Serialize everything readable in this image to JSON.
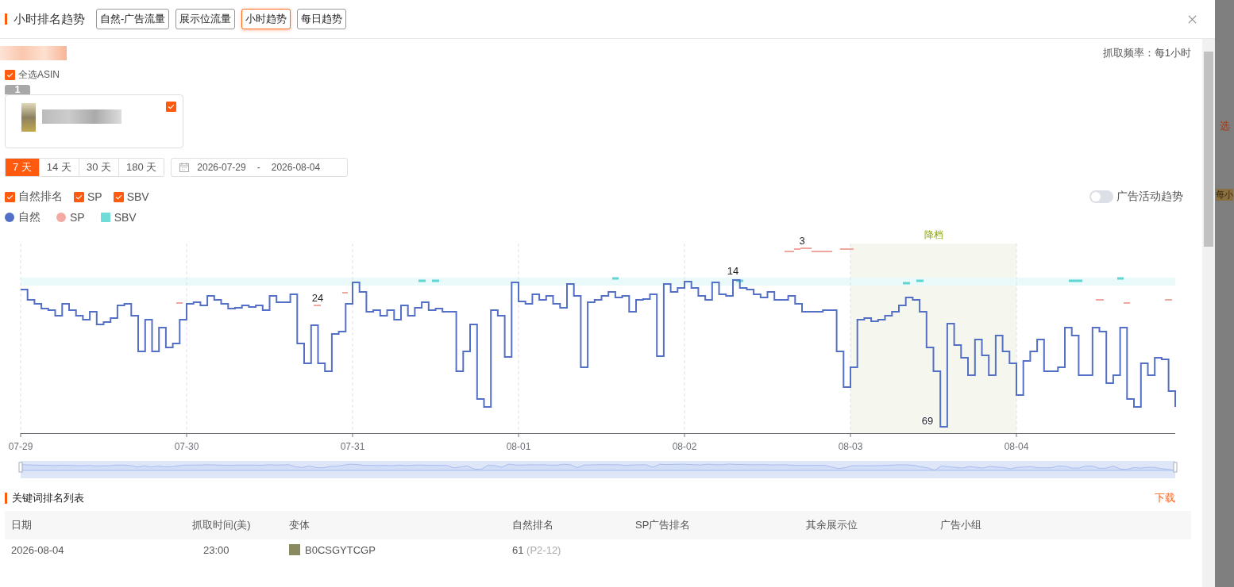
{
  "header": {
    "title": "小时排名趋势",
    "tabs": [
      {
        "label": "自然-广告流量",
        "selected": false
      },
      {
        "label": "展示位流量",
        "selected": false
      },
      {
        "label": "小时趋势",
        "selected": true
      },
      {
        "label": "每日趋势",
        "selected": false
      }
    ]
  },
  "crawl_frequency": "抓取频率：每1小时",
  "select_all": {
    "label": "全选ASIN",
    "checked": true
  },
  "asin_card": {
    "index": "1",
    "checked": true
  },
  "ranges": [
    {
      "label": "7 天",
      "selected": true
    },
    {
      "label": "14 天",
      "selected": false
    },
    {
      "label": "30 天",
      "selected": false
    },
    {
      "label": "180 天",
      "selected": false
    }
  ],
  "date_range": {
    "start": "2026-07-29",
    "separator": "-",
    "end": "2026-08-04"
  },
  "series_toggles": [
    {
      "label": "自然排名",
      "checked": true
    },
    {
      "label": "SP",
      "checked": true
    },
    {
      "label": "SBV",
      "checked": true
    }
  ],
  "ad_trend_switch": {
    "label": "广告活动趋势",
    "on": false
  },
  "legend": [
    {
      "label": "自然",
      "kind": "circle",
      "color": "#5470c6"
    },
    {
      "label": "SP",
      "kind": "circle",
      "color": "#f4aaa2"
    },
    {
      "label": "SBV",
      "kind": "square",
      "color": "#6fdcd8"
    }
  ],
  "chart": {
    "x_labels": [
      "07-29",
      "07-30",
      "07-31",
      "08-01",
      "08-02",
      "08-03",
      "08-04"
    ],
    "band_label": "降档",
    "point_labels": [
      "24",
      "14",
      "3",
      "69"
    ]
  },
  "keyword_table": {
    "title": "关键词排名列表",
    "download": "下载",
    "columns": [
      "日期",
      "抓取时间(美)",
      "变体",
      "自然排名",
      "SP广告排名",
      "其余展示位",
      "广告小组"
    ],
    "rows": [
      {
        "date": "2026-08-04",
        "time": "23:00",
        "variant": "B0CSGYTCGP",
        "organic_rank": "61",
        "organic_detail": "(P2-12)"
      }
    ]
  },
  "zoom_slider": {
    "level": 1
  },
  "backdrop": {
    "texts": [
      "选",
      "每小"
    ]
  }
}
